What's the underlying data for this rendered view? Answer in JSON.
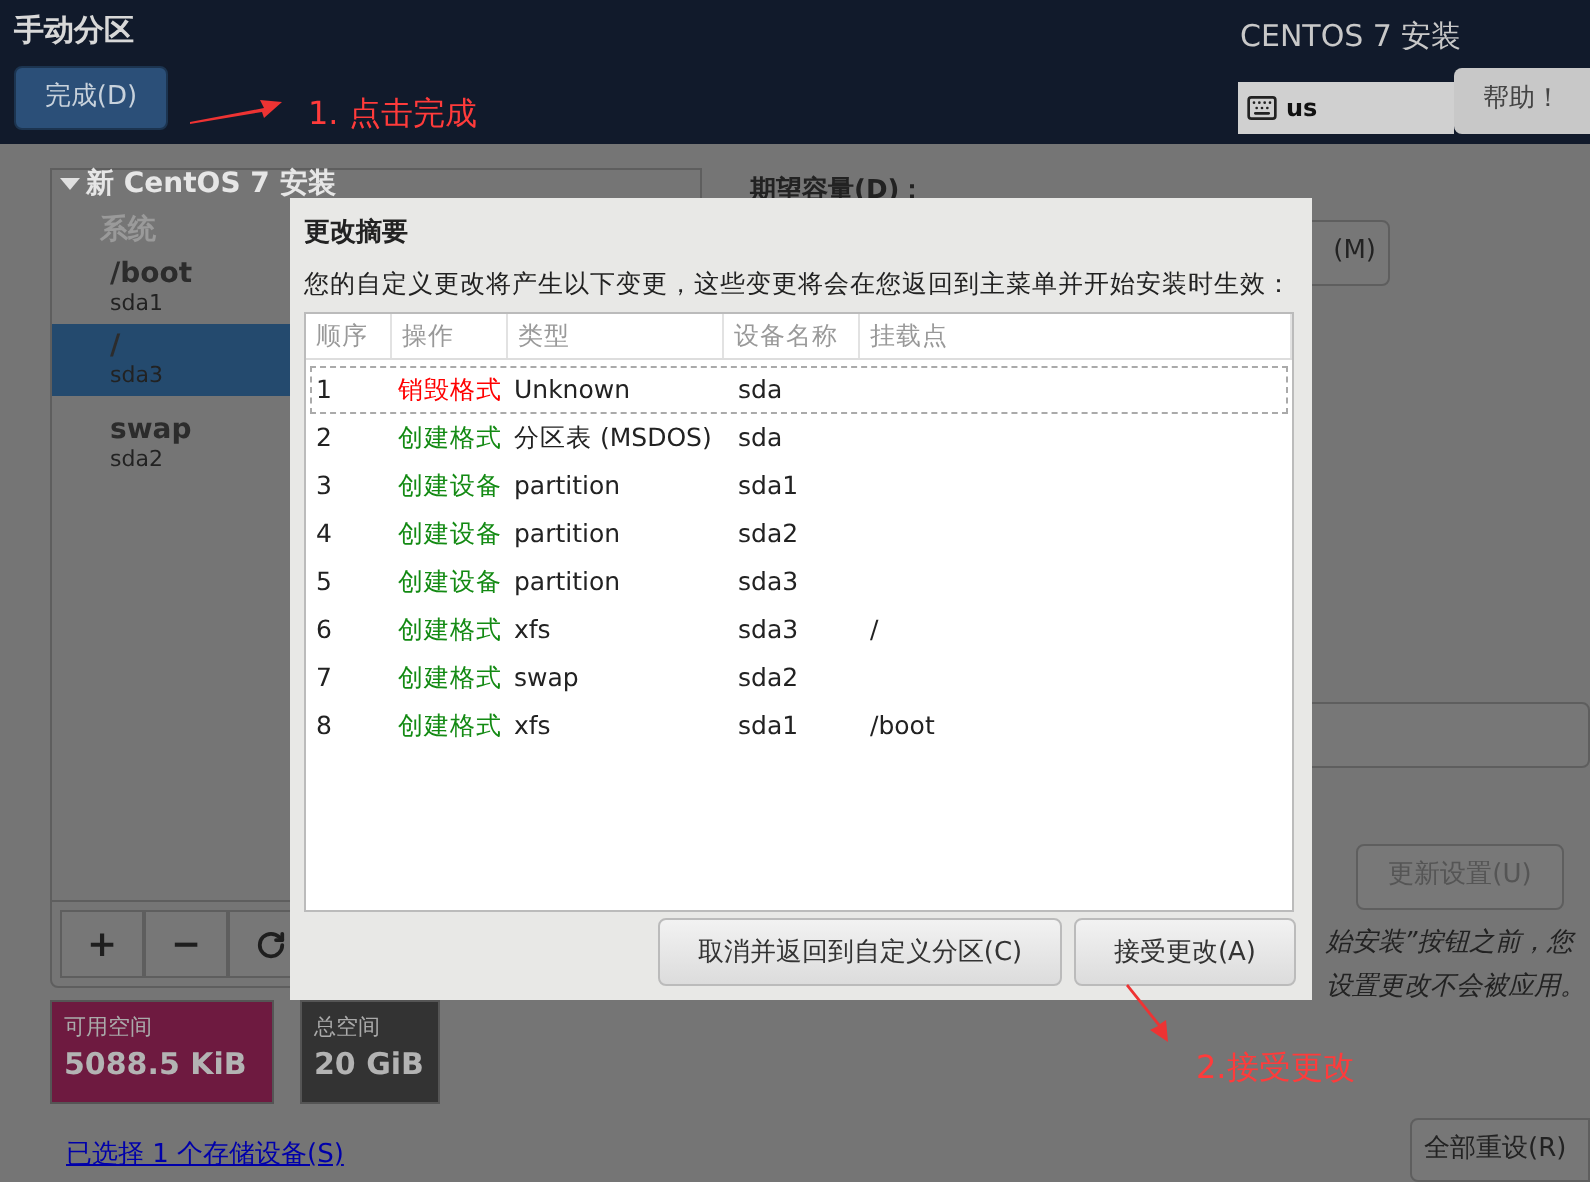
{
  "header": {
    "title": "手动分区",
    "done_button": "完成(D)",
    "product": "CENTOS 7 安装",
    "keyboard": "us",
    "help_button": "帮助！"
  },
  "partitions": {
    "group": "新 CentOS 7 安装",
    "expanded": true,
    "section": "系统",
    "items": [
      {
        "mount": "/boot",
        "device": "sda1",
        "selected": false
      },
      {
        "mount": "/",
        "device": "sda3",
        "selected": true
      },
      {
        "mount": "swap",
        "device": "sda2",
        "selected": false
      }
    ]
  },
  "toolbar": [
    "+",
    "−"
  ],
  "space": [
    {
      "label": "可用空间",
      "value": "5088.5 KiB",
      "kind": "available"
    },
    {
      "label": "总空间",
      "value": "20 GiB",
      "kind": "total"
    }
  ],
  "storage_link": "已选择 1 个存储设备(S)",
  "details": {
    "capacity_label": "期望容量(D)：",
    "modify_button": "(M)",
    "update_button": {
      "label": "更新设置(U)",
      "disabled": true
    },
    "note_lines": [
      "始安装”按钮之前，您",
      "设置更改不会被应用。"
    ],
    "reset_button": "全部重设(R)"
  },
  "dialog": {
    "title": "更改摘要",
    "description": "您的自定义更改将产生以下变更，这些变更将会在您返回到主菜单并开始安装时生效：",
    "columns": [
      "顺序",
      "操作",
      "类型",
      "设备名称",
      "挂载点"
    ],
    "rows": [
      {
        "order": "1",
        "action": "销毁格式",
        "color": "#ff0000",
        "type": "Unknown",
        "device": "sda",
        "selected": true
      },
      {
        "order": "2",
        "action": "创建格式",
        "color": "#138a13",
        "type": "分区表 (MSDOS)",
        "device": "sda",
        "selected": false
      },
      {
        "order": "3",
        "action": "创建设备",
        "color": "#138a13",
        "type": "partition",
        "device": "sda1",
        "selected": false
      },
      {
        "order": "4",
        "action": "创建设备",
        "color": "#138a13",
        "type": "partition",
        "device": "sda2",
        "selected": false
      },
      {
        "order": "5",
        "action": "创建设备",
        "color": "#138a13",
        "type": "partition",
        "device": "sda3",
        "selected": false
      },
      {
        "order": "6",
        "action": "创建格式",
        "color": "#138a13",
        "type": "xfs",
        "device": "sda3",
        "mount": "/",
        "selected": false
      },
      {
        "order": "7",
        "action": "创建格式",
        "color": "#138a13",
        "type": "swap",
        "device": "sda2",
        "selected": false
      },
      {
        "order": "8",
        "action": "创建格式",
        "color": "#138a13",
        "type": "xfs",
        "device": "sda1",
        "mount": "/boot",
        "selected": false
      }
    ],
    "buttons": [
      "取消并返回到自定义分区(C)",
      "接受更改(A)"
    ]
  },
  "annotations": [
    "1. 点击完成",
    "2.接受更改"
  ]
}
